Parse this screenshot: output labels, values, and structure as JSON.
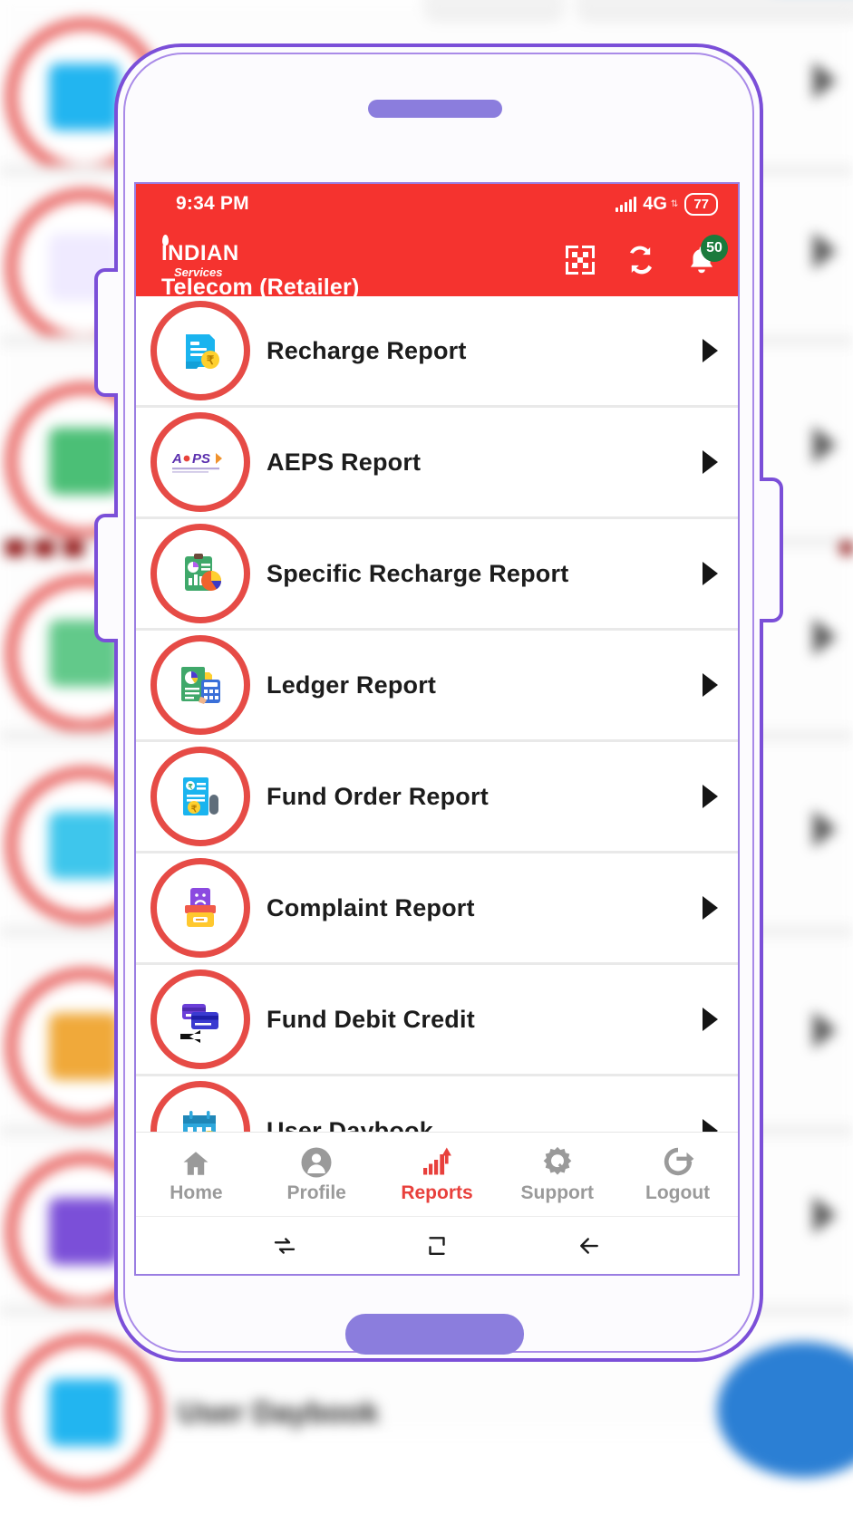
{
  "app": {
    "brand_name": "INDIAN",
    "brand_sub": "Services",
    "title": "Telecom (Retailer)"
  },
  "status_bar": {
    "time": "9:34 PM",
    "network": "4G",
    "network_sub": "⇅",
    "battery": "77"
  },
  "header_actions": {
    "qr_icon": "qr-scan-icon",
    "refresh_icon": "refresh-icon",
    "notification_icon": "bell-icon",
    "notification_count": "50"
  },
  "colors": {
    "brand_red": "#f5332f",
    "accent_red": "#e8403c",
    "badge_green": "#1a7a3c",
    "frame_purple": "#7b4fd8",
    "muted_gray": "#9a9a9a"
  },
  "report_list": [
    {
      "label": "Recharge Report",
      "icon": "recharge-report-icon"
    },
    {
      "label": "AEPS Report",
      "icon": "aeps-report-icon"
    },
    {
      "label": "Specific Recharge Report",
      "icon": "specific-recharge-report-icon"
    },
    {
      "label": "Ledger Report",
      "icon": "ledger-report-icon"
    },
    {
      "label": "Fund Order Report",
      "icon": "fund-order-report-icon"
    },
    {
      "label": "Complaint Report",
      "icon": "complaint-report-icon"
    },
    {
      "label": "Fund Debit Credit",
      "icon": "fund-debit-credit-icon"
    },
    {
      "label": "User Daybook",
      "icon": "user-daybook-icon"
    }
  ],
  "bottom_nav": [
    {
      "label": "Home",
      "icon": "home-icon",
      "active": false
    },
    {
      "label": "Profile",
      "icon": "profile-icon",
      "active": false
    },
    {
      "label": "Reports",
      "icon": "reports-chart-icon",
      "active": true
    },
    {
      "label": "Support",
      "icon": "gear-wrench-icon",
      "active": false
    },
    {
      "label": "Logout",
      "icon": "logout-icon",
      "active": false
    }
  ],
  "system_nav": [
    {
      "icon": "recent-apps-icon"
    },
    {
      "icon": "home-square-icon"
    },
    {
      "icon": "back-arrow-icon"
    }
  ],
  "aeps_logo_text": "AePS"
}
